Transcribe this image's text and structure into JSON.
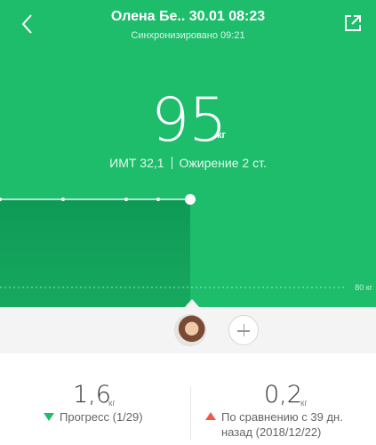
{
  "header": {
    "title": "Олена Бе.. 30.01 08:23",
    "sync_status": "Синхронизировано 09:21",
    "back_icon": "chevron-left-icon",
    "share_icon": "share-icon"
  },
  "measurement": {
    "weight": "95",
    "unit": "кг",
    "bmi": "ИМТ 32,1",
    "category": "Ожирение 2 ст."
  },
  "chart": {
    "reference_label": "80 кг"
  },
  "chart_data": {
    "type": "area",
    "values": [
      95.0,
      95.1,
      95.2,
      95.1,
      95.0
    ],
    "ylim": [
      80,
      100
    ],
    "reference_line": 80,
    "selected_index": 4
  },
  "users": {
    "avatar_icon": "user-avatar",
    "add_icon": "plus-icon"
  },
  "stats": {
    "progress": {
      "value": "1,6",
      "unit": "кг",
      "label": "Прогресс (1/29)",
      "direction": "down"
    },
    "comparison": {
      "value": "0,2",
      "unit": "кг",
      "label_line1": "По сравнению с 39 дн.",
      "label_line2": "назад (2018/12/22)",
      "direction": "up"
    }
  },
  "colors": {
    "accent": "#1dbd6c",
    "decrease": "#1dbd6c",
    "increase": "#f05a4a"
  }
}
